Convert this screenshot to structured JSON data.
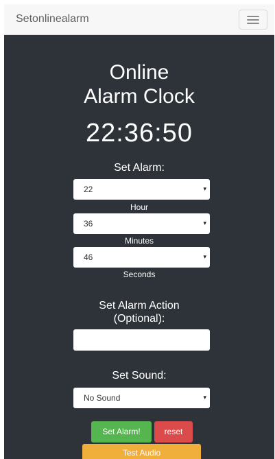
{
  "navbar": {
    "brand": "Setonlinealarm",
    "menu_icon": "hamburger-menu-icon"
  },
  "main": {
    "title_line1": "Online",
    "title_line2": "Alarm Clock",
    "clock_time": "22:36:50",
    "set_alarm_label": "Set Alarm:",
    "hour": {
      "value": "22",
      "label": "Hour"
    },
    "minutes": {
      "value": "36",
      "label": "Minutes"
    },
    "seconds": {
      "value": "46",
      "label": "Seconds"
    },
    "dropdown_arrow": "▾",
    "action_label_line1": "Set Alarm Action",
    "action_label_line2": "(Optional):",
    "action_value": "",
    "sound_label": "Set Sound:",
    "sound_value": "No Sound",
    "buttons": {
      "set_alarm": "Set Alarm!",
      "reset": "reset",
      "test_audio": "Test Audio"
    }
  },
  "colors": {
    "background": "#2d3339",
    "navbar": "#f7f7f7",
    "set_button": "#55b64f",
    "reset_button": "#db4b4b",
    "test_audio_button": "#f0ae3a"
  }
}
